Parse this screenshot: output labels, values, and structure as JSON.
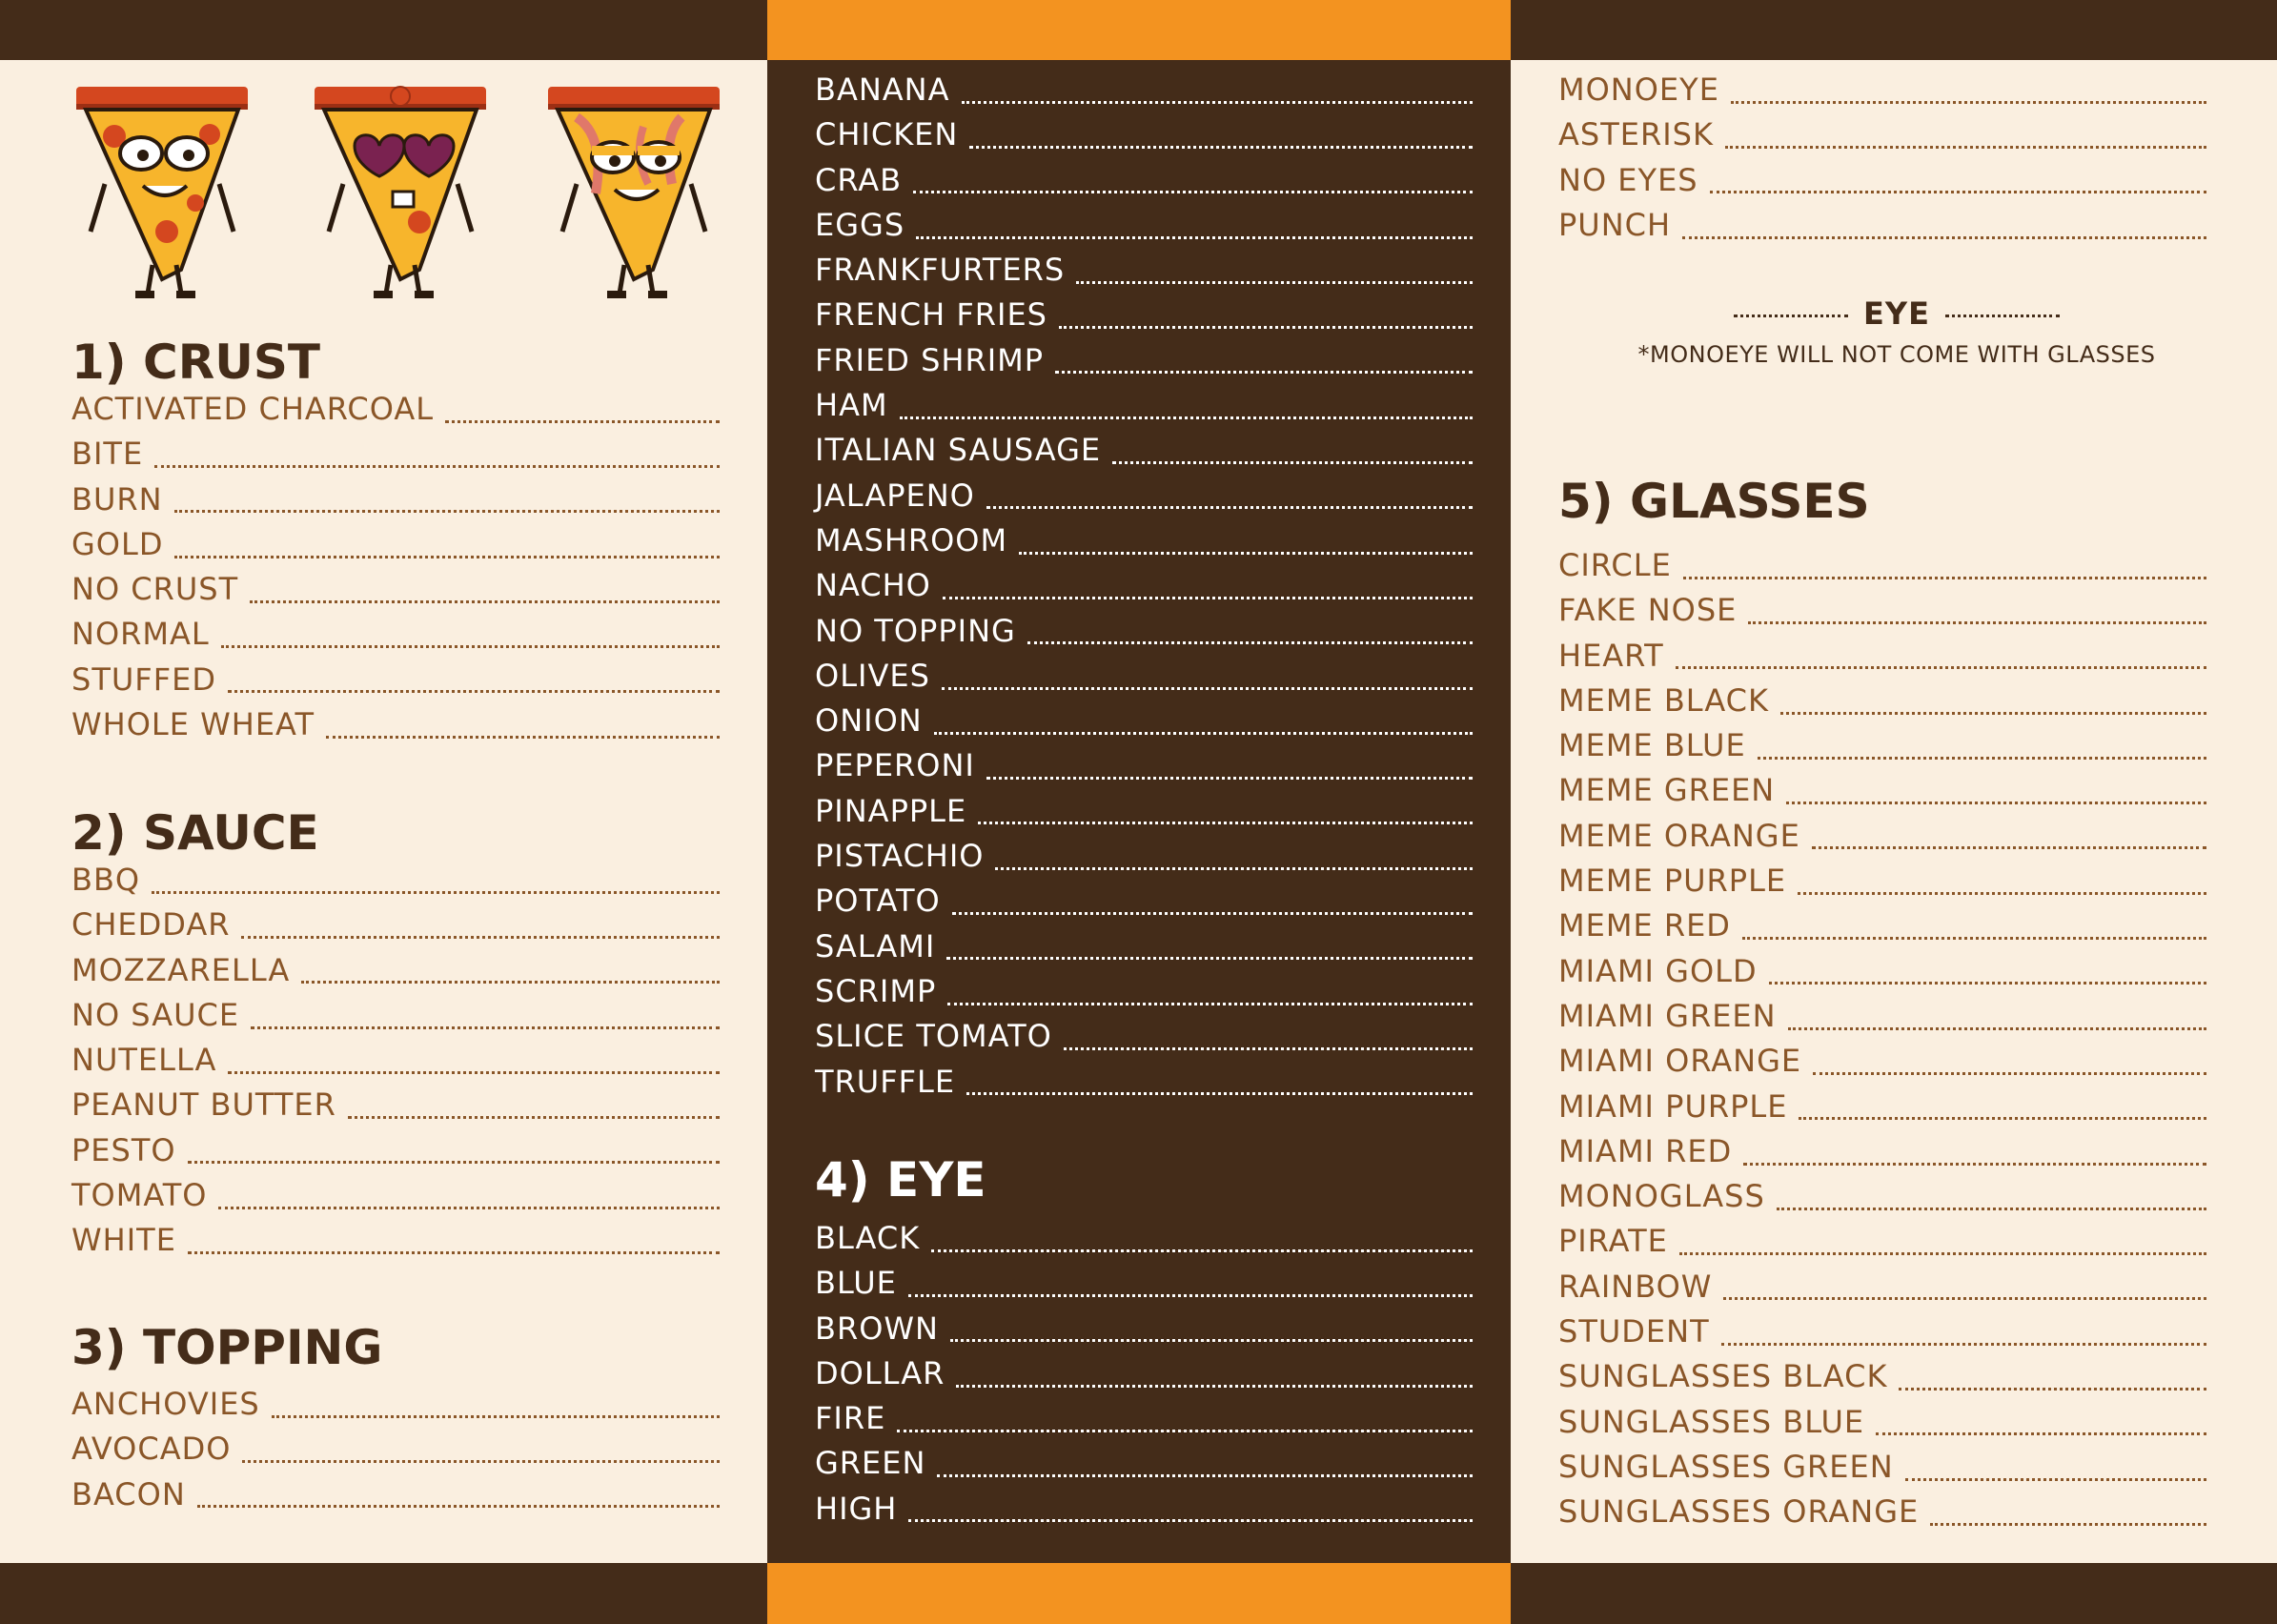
{
  "colors": {
    "cream": "#faefe0",
    "dark_brown": "#442c19",
    "orange": "#f39320",
    "text_brown": "#8a5628"
  },
  "sections": {
    "crust": {
      "title": "1) CRUST",
      "items": [
        "ACTIVATED CHARCOAL",
        "BITE",
        "BURN",
        "GOLD",
        "NO CRUST",
        "NORMAL",
        "STUFFED",
        "WHOLE WHEAT"
      ]
    },
    "sauce": {
      "title": "2) SAUCE",
      "items": [
        "BBQ",
        "CHEDDAR",
        "MOZZARELLA",
        "NO SAUCE",
        "NUTELLA",
        "PEANUT BUTTER",
        "PESTO",
        "TOMATO",
        "WHITE"
      ]
    },
    "topping_left": {
      "title": "3) TOPPING",
      "items": [
        "ANCHOVIES",
        "AVOCADO",
        "BACON"
      ]
    },
    "topping_mid": {
      "items": [
        "BANANA",
        "CHICKEN",
        "CRAB",
        "EGGS",
        "FRANKFURTERS",
        "FRENCH FRIES",
        "FRIED SHRIMP",
        "HAM",
        "ITALIAN SAUSAGE",
        "JALAPENO",
        "MASHROOM",
        "NACHO",
        "NO TOPPING",
        "OLIVES",
        "ONION",
        "PEPERONI",
        "PINAPPLE",
        "PISTACHIO",
        "POTATO",
        "SALAMI",
        "SCRIMP",
        "SLICE TOMATO",
        "TRUFFLE"
      ]
    },
    "eye_mid": {
      "title": "4) EYE",
      "items": [
        "BLACK",
        "BLUE",
        "BROWN",
        "DOLLAR",
        "FIRE",
        "GREEN",
        "HIGH"
      ]
    },
    "eye_right": {
      "items": [
        "MONOEYE",
        "ASTERISK",
        "NO EYES",
        "PUNCH"
      ],
      "footer_title": "EYE",
      "footer_note": "*MONOEYE WILL NOT COME WITH GLASSES"
    },
    "glasses": {
      "title": "5) GLASSES",
      "items": [
        "CIRCLE",
        "FAKE NOSE",
        "HEART",
        "MEME BLACK",
        "MEME BLUE",
        "MEME GREEN",
        "MEME ORANGE",
        "MEME PURPLE",
        "MEME RED",
        "MIAMI GOLD",
        "MIAMI GREEN",
        "MIAMI ORANGE",
        "MIAMI PURPLE",
        "MIAMI RED",
        "MONOGLASS",
        "PIRATE",
        "RAINBOW",
        "STUDENT",
        "SUNGLASSES BLACK",
        "SUNGLASSES BLUE",
        "SUNGLASSES GREEN",
        "SUNGLASSES ORANGE"
      ]
    }
  },
  "mascots": [
    {
      "name": "pepperoni-pizza-icon",
      "variant": "pepperoni"
    },
    {
      "name": "heart-glasses-pizza-icon",
      "variant": "heart-glasses"
    },
    {
      "name": "bacon-pizza-icon",
      "variant": "bacon"
    }
  ]
}
